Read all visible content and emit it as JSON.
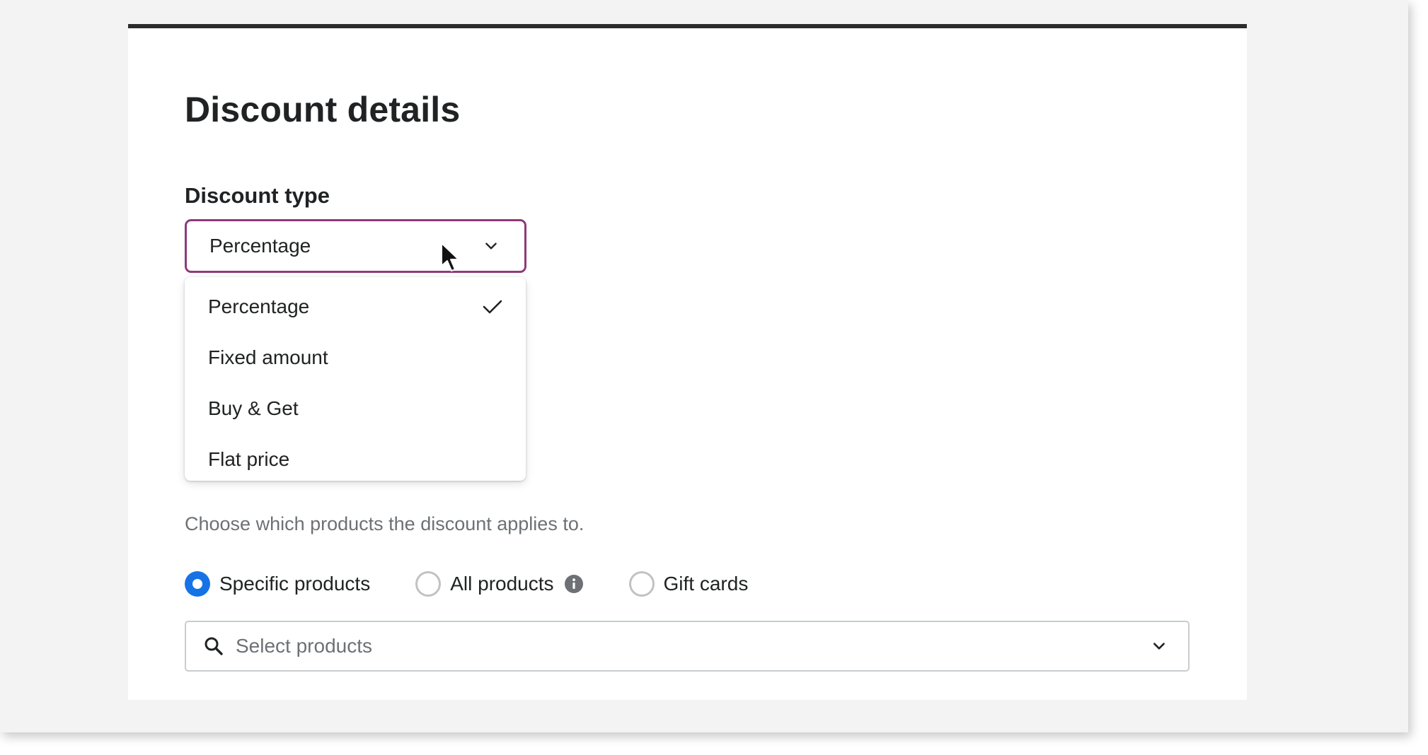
{
  "page": {
    "title": "Discount details"
  },
  "discount_type": {
    "label": "Discount type",
    "selected": "Percentage",
    "options": [
      {
        "label": "Percentage",
        "selected": true
      },
      {
        "label": "Fixed amount",
        "selected": false
      },
      {
        "label": "Buy & Get",
        "selected": false
      },
      {
        "label": "Flat price",
        "selected": false
      }
    ]
  },
  "applies_to": {
    "helper_text": "Choose which products the discount applies to.",
    "radios": [
      {
        "label": "Specific products",
        "checked": true
      },
      {
        "label": "All products",
        "checked": false,
        "icon": "info-icon"
      },
      {
        "label": "Gift cards",
        "checked": false
      }
    ],
    "product_select_placeholder": "Select products"
  },
  "colors": {
    "focus_border": "#8e3a78",
    "radio_checked": "#1673e6",
    "helper_text": "#6d7175",
    "top_border": "#2b2b2b"
  }
}
